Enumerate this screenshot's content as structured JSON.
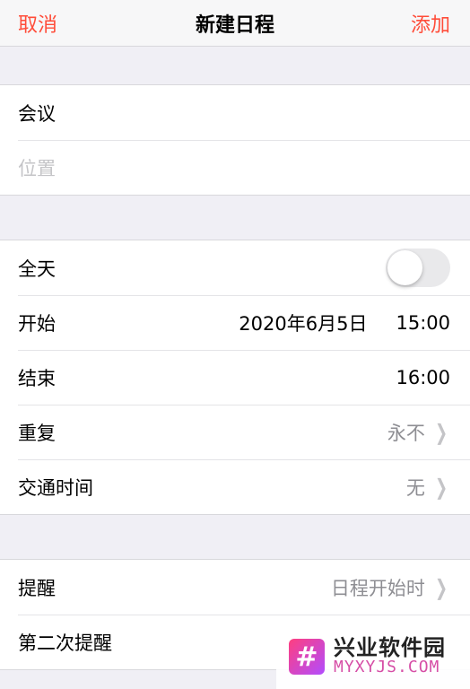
{
  "nav": {
    "cancel": "取消",
    "title": "新建日程",
    "add": "添加"
  },
  "details": {
    "title_value": "会议",
    "location_placeholder": "位置"
  },
  "time": {
    "all_day_label": "全天",
    "all_day_on": false,
    "start_label": "开始",
    "start_date": "2020年6月5日",
    "start_time": "15:00",
    "end_label": "结束",
    "end_time": "16:00",
    "repeat_label": "重复",
    "repeat_value": "永不",
    "travel_label": "交通时间",
    "travel_value": "无"
  },
  "alerts": {
    "alert_label": "提醒",
    "alert_value": "日程开始时",
    "second_alert_label": "第二次提醒"
  },
  "watermark": {
    "logo_char": "#",
    "name": "兴业软件园",
    "site": "MYXYJS.COM"
  },
  "colors": {
    "accent": "#ff4d3a",
    "background": "#f0eff5"
  }
}
